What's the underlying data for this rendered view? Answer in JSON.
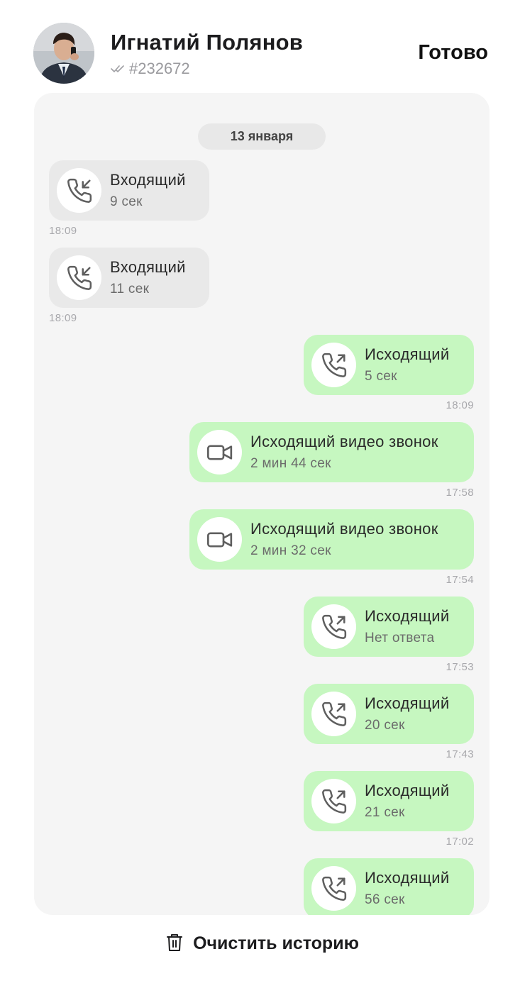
{
  "header": {
    "contact_name": "Игнатий Полянов",
    "contact_id": "#232672",
    "done_label": "Готово"
  },
  "chat": {
    "date_separator": "13 января",
    "calls": [
      {
        "direction": "in",
        "kind": "voice",
        "title": "Входящий",
        "duration": "9 сек",
        "time": "18:09",
        "icon": "phone-incoming-icon"
      },
      {
        "direction": "in",
        "kind": "voice",
        "title": "Входящий",
        "duration": "11 сек",
        "time": "18:09",
        "icon": "phone-incoming-icon"
      },
      {
        "direction": "out",
        "kind": "voice",
        "title": "Исходящий",
        "duration": "5 сек",
        "time": "18:09",
        "icon": "phone-outgoing-icon"
      },
      {
        "direction": "out",
        "kind": "video",
        "title": "Исходящий видео звонок",
        "duration": "2 мин 44 сек",
        "time": "17:58",
        "icon": "video-camera-icon"
      },
      {
        "direction": "out",
        "kind": "video",
        "title": "Исходящий видео звонок",
        "duration": "2 мин 32 сек",
        "time": "17:54",
        "icon": "video-camera-icon"
      },
      {
        "direction": "out",
        "kind": "voice",
        "title": "Исходящий",
        "duration": "Нет ответа",
        "time": "17:53",
        "icon": "phone-outgoing-icon"
      },
      {
        "direction": "out",
        "kind": "voice",
        "title": "Исходящий",
        "duration": "20 сек",
        "time": "17:43",
        "icon": "phone-outgoing-icon"
      },
      {
        "direction": "out",
        "kind": "voice",
        "title": "Исходящий",
        "duration": "21 сек",
        "time": "17:02",
        "icon": "phone-outgoing-icon"
      },
      {
        "direction": "out",
        "kind": "voice",
        "title": "Исходящий",
        "duration": "56 сек",
        "time": "",
        "icon": "phone-outgoing-icon"
      }
    ]
  },
  "footer": {
    "clear_label": "Очистить историю"
  },
  "colors": {
    "incoming_bubble": "#e9e9e9",
    "outgoing_bubble": "#c6f7c0",
    "panel_background": "#f5f5f5",
    "date_pill": "#e8e8e8"
  }
}
